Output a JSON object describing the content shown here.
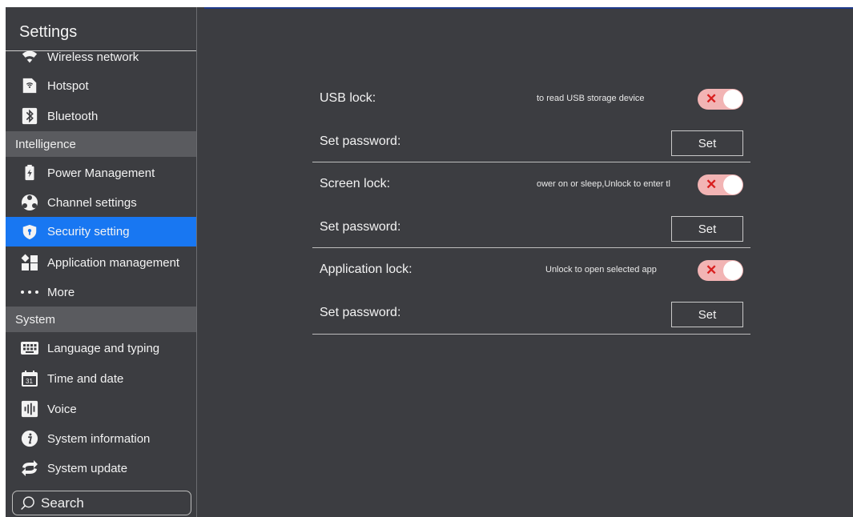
{
  "sidebar": {
    "title": "Settings",
    "items_top": [
      {
        "label": "Wireless network",
        "icon": "wifi-icon"
      },
      {
        "label": "Hotspot",
        "icon": "hotspot-icon"
      },
      {
        "label": "Bluetooth",
        "icon": "bluetooth-icon"
      }
    ],
    "section_intelligence": "Intelligence",
    "items_intelligence": [
      {
        "label": "Power Management",
        "icon": "battery-icon"
      },
      {
        "label": "Channel settings",
        "icon": "channel-icon"
      },
      {
        "label": "Security setting",
        "icon": "shield-icon",
        "active": true
      },
      {
        "label": "Application management",
        "icon": "apps-icon"
      },
      {
        "label": "More",
        "icon": "more-dots-icon"
      }
    ],
    "section_system": "System",
    "items_system": [
      {
        "label": "Language and typing",
        "icon": "keyboard-icon"
      },
      {
        "label": "Time and date",
        "icon": "calendar-icon",
        "icon_text": "31"
      },
      {
        "label": "Voice",
        "icon": "voice-icon"
      },
      {
        "label": "System information",
        "icon": "info-icon"
      },
      {
        "label": "System update",
        "icon": "update-icon"
      }
    ],
    "search_placeholder": "Search"
  },
  "main": {
    "usb_lock": {
      "label": "USB lock:",
      "description": "to read USB storage device",
      "enabled": false
    },
    "usb_password": {
      "label": "Set password:",
      "button": "Set"
    },
    "screen_lock": {
      "label": "Screen lock:",
      "description": "ower on or sleep,Unlock to enter tl",
      "enabled": false
    },
    "screen_password": {
      "label": "Set password:",
      "button": "Set"
    },
    "app_lock": {
      "label": "Application lock:",
      "description": "Unlock to open selected app",
      "enabled": false
    },
    "app_password": {
      "label": "Set password:",
      "button": "Set"
    }
  },
  "colors": {
    "background": "#3c3d41",
    "section": "#5a5b5f",
    "active": "#1877f2",
    "toggle_off": "#f2b4b4",
    "toggle_x": "#d81f1f"
  }
}
